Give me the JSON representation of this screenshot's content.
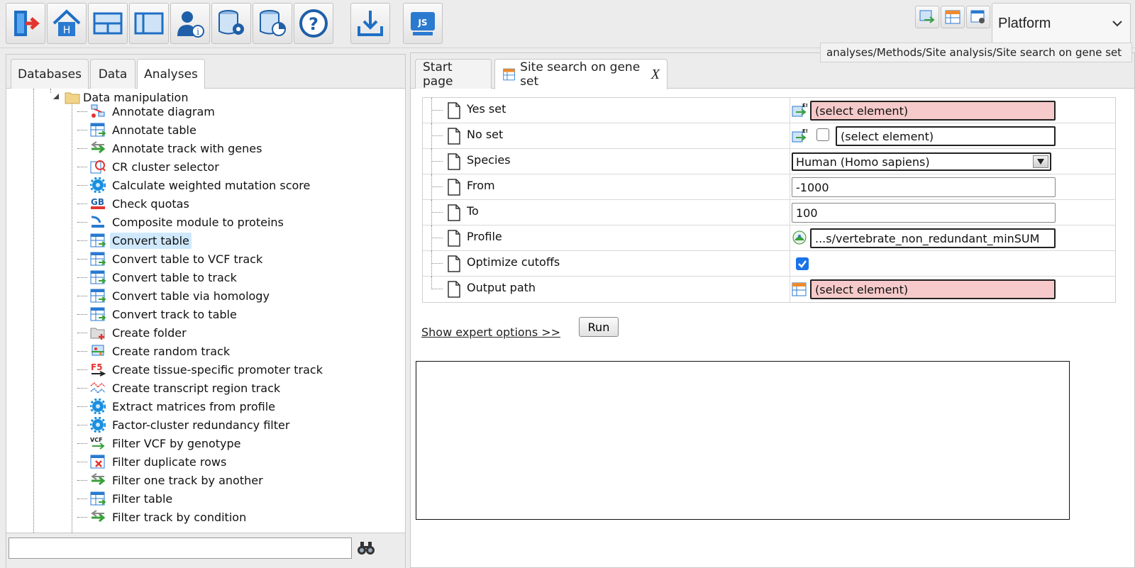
{
  "toolbar": {
    "buttons": [
      "logout-icon",
      "home-icon",
      "split-horizontal-icon",
      "split-vertical-icon",
      "user-info-icon",
      "database-settings-icon",
      "database-chart-icon",
      "help-icon",
      "import-icon",
      "javascript-console-icon"
    ],
    "small_buttons": [
      "track-icon",
      "table-icon",
      "table-settings-icon"
    ],
    "platform_label": "Platform"
  },
  "tooltip": "analyses/Methods/Site analysis/Site search on gene set",
  "left": {
    "tabs": [
      "Databases",
      "Data",
      "Analyses"
    ],
    "active_tab": "Analyses",
    "tree_parent": "Data manipulation",
    "items": [
      {
        "label": "Annotate diagram",
        "icon": "diagram-icon"
      },
      {
        "label": "Annotate table",
        "icon": "table-add-icon"
      },
      {
        "label": "Annotate track with genes",
        "icon": "track-arrows-icon"
      },
      {
        "label": "CR cluster selector",
        "icon": "cluster-icon"
      },
      {
        "label": "Calculate weighted mutation score",
        "icon": "gear-icon"
      },
      {
        "label": "Check quotas",
        "icon": "gb-icon"
      },
      {
        "label": "Composite module to proteins",
        "icon": "module-icon"
      },
      {
        "label": "Convert table",
        "icon": "table-convert-icon"
      },
      {
        "label": "Convert table to VCF track",
        "icon": "table-track-icon"
      },
      {
        "label": "Convert table to track",
        "icon": "table-track-icon"
      },
      {
        "label": "Convert table via homology",
        "icon": "table-convert-icon"
      },
      {
        "label": "Convert track to table",
        "icon": "table-track-icon"
      },
      {
        "label": "Create folder",
        "icon": "folder-add-icon"
      },
      {
        "label": "Create random track",
        "icon": "random-track-icon"
      },
      {
        "label": "Create tissue-specific promoter track",
        "icon": "f5-icon"
      },
      {
        "label": "Create transcript region track",
        "icon": "transcript-icon"
      },
      {
        "label": "Extract matrices from profile",
        "icon": "gear-icon"
      },
      {
        "label": "Factor-cluster redundancy filter",
        "icon": "gear-icon"
      },
      {
        "label": "Filter VCF by genotype",
        "icon": "vcf-icon"
      },
      {
        "label": "Filter duplicate rows",
        "icon": "table-remove-icon"
      },
      {
        "label": "Filter one track by another",
        "icon": "track-filter-icon"
      },
      {
        "label": "Filter table",
        "icon": "table-filter-icon"
      },
      {
        "label": "Filter track by condition",
        "icon": "track-arrows-icon"
      }
    ],
    "selected_item": "Convert table",
    "search_value": ""
  },
  "right": {
    "tabs": [
      "Start page",
      "Site search on gene set"
    ],
    "tab_close": "X",
    "params": [
      {
        "name": "Yes set",
        "value": "(select element)"
      },
      {
        "name": "No set",
        "value": "(select element)"
      },
      {
        "name": "Species",
        "value": "Human (Homo sapiens)"
      },
      {
        "name": "From",
        "value": "-1000"
      },
      {
        "name": "To",
        "value": "100"
      },
      {
        "name": "Profile",
        "value": "...s/vertebrate_non_redundant_minSUM"
      },
      {
        "name": "Optimize cutoffs",
        "value": "checked"
      },
      {
        "name": "Output path",
        "value": "(select element)"
      }
    ],
    "expert_link": "Show expert options >>",
    "run_label": "Run"
  },
  "colors": {
    "invalid_field": "#f6caca",
    "selection": "#cfe8fc",
    "checkbox": "#1a73e8"
  }
}
